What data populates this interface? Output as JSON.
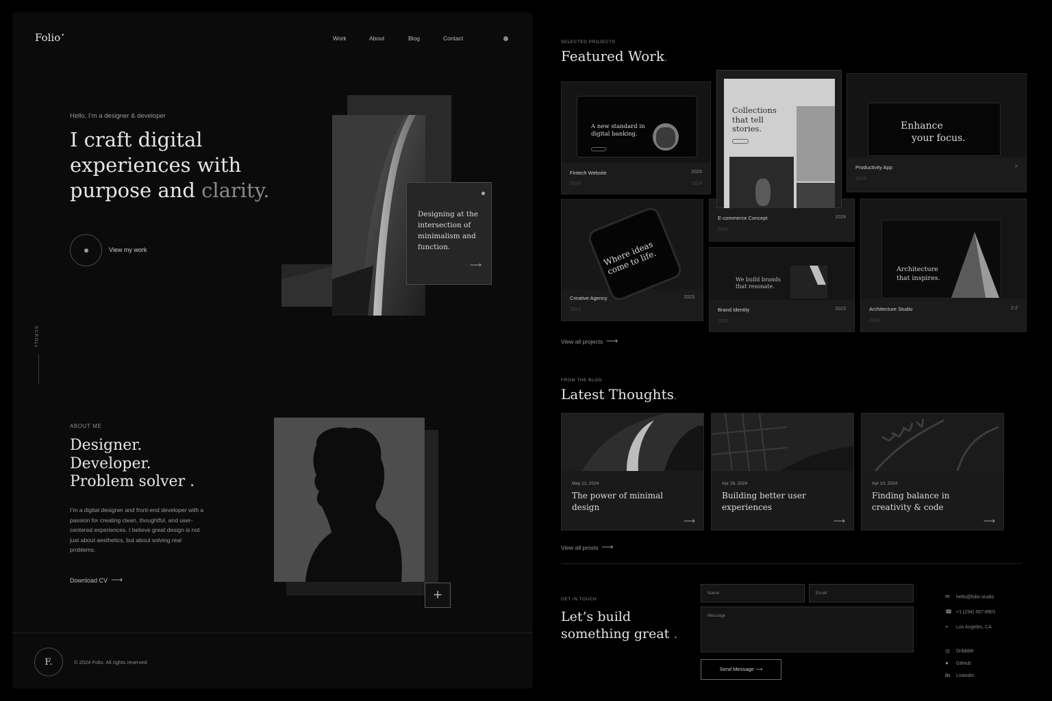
{
  "left": {
    "logo": "Folio",
    "logo_mark": "•",
    "nav": [
      "Work",
      "About",
      "Blog",
      "Contact"
    ],
    "hello": "Hello, I’m a designer & developer",
    "hero_line1": "I craft digital",
    "hero_line2": "experiences with",
    "hero_line3a": "purpose and ",
    "hero_line3b": "clarity",
    "hero_dot": ".",
    "view_work": "View my work",
    "scroll": "SCROLL",
    "quote": "Designing at the intersection of minimalism and function.",
    "quote_arrow": "⟶",
    "about_label": "ABOUT ME",
    "about_l1": "Designer.",
    "about_l2": "Developer.",
    "about_l3": "Problem solver .",
    "about_text": "I’m a digital designer and front-end developer with a passion for creating clean, thoughtful, and user-centered experiences. I believe great design is not just about aesthetics, but about solving real problems.",
    "download": "Download CV",
    "download_arrow": "⟶",
    "plus": "+",
    "footer_logo": "F.",
    "copyright": "© 2024 Folio. All rights reserved."
  },
  "work": {
    "label": "SELECTED PROJECTS",
    "title": "Featured Work",
    "dot": ".",
    "projects": [
      {
        "name": "Fintech Website",
        "year": "2024",
        "ghost": "2024",
        "shot_text": "A new standard in digital banking."
      },
      {
        "name": "E-commerce Concept",
        "year": "2024",
        "ghost": "2024",
        "shot_text": "Collections that tell stories."
      },
      {
        "name": "Productivity App",
        "year": ">",
        "ghost": "2023",
        "shot_text_a": "Enhance",
        "shot_text_b": "your focus."
      },
      {
        "name": "Creative Agency",
        "year": "2023",
        "ghost": "2023",
        "shot_text": "Where ideas come to life."
      },
      {
        "name": "Brand Identity",
        "year": "2023",
        "ghost": "2023",
        "shot_text": "We build brands that resonate."
      },
      {
        "name": "Architecture Studio",
        "year": "2-2",
        "ghost": "2024",
        "shot_text": "Architecture that inspires."
      }
    ],
    "view_all": "View all projects",
    "arrow": "⟶"
  },
  "blog": {
    "label": "FROM THE BLOG",
    "title": "Latest Thoughts",
    "dot": ".",
    "posts": [
      {
        "date": "May 12, 2024",
        "title": "The power of minimal design"
      },
      {
        "date": "Apr 28, 2024",
        "title": "Building better user experiences"
      },
      {
        "date": "Apr 10, 2024",
        "title": "Finding balance in creativity & code"
      }
    ],
    "view_all": "View all prosts",
    "arrow": "⟶"
  },
  "contact": {
    "label": "GET IN TOUCH",
    "title_l1": "Let’s build",
    "title_l2": "something great",
    "dot": ".",
    "name_placeholder": "Name",
    "email_placeholder": "Email",
    "message_placeholder": "Message",
    "send": "Send Message ⟶",
    "email": "hello@folio.studio",
    "phone": "+1 (234) 567-8901",
    "location": "Los Angeles, CA",
    "social": [
      "Dribbble",
      "GitHub",
      "LinkedIn"
    ]
  },
  "colors": {
    "background": "#000000",
    "panel": "#0b0b0b",
    "accent_text": "#e6e6e6",
    "muted": "#8a8a8a"
  }
}
